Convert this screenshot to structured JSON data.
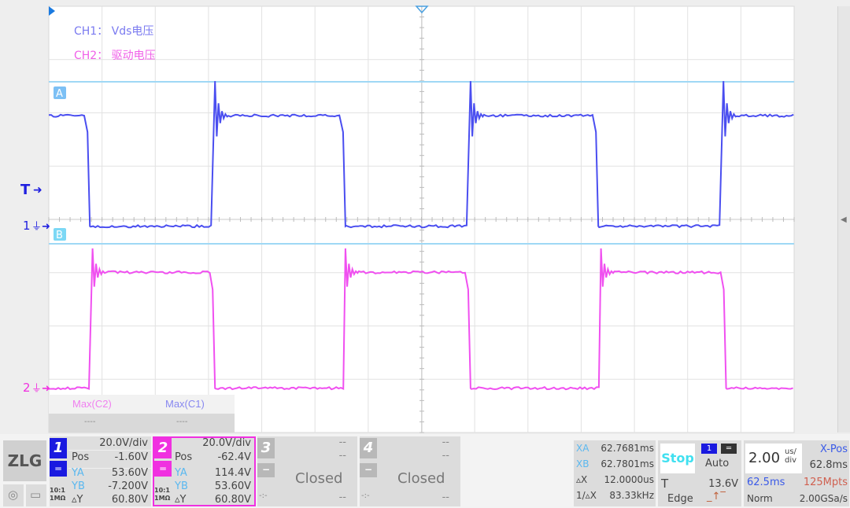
{
  "annotations": {
    "ch1": "CH1：  Vds电压",
    "ch2": "CH2：  驱动电压"
  },
  "markers": {
    "trigger": "T",
    "ch1": "1",
    "ch2": "2",
    "cursor_a": "A",
    "cursor_b": "B"
  },
  "colors": {
    "ch1": "#4a4ef0",
    "ch2": "#f050f0",
    "cursor": "#9fd8f5",
    "grid": "#dcdcdc"
  },
  "measurements": {
    "headers": [
      "Max(C2)",
      "Max(C1)"
    ],
    "values": [
      "----",
      "----"
    ]
  },
  "waveforms": {
    "time_unit": "us relative to screen center",
    "ch1": {
      "high_v": 41,
      "low_v": -0.5,
      "overshoot_v": 54,
      "edges": [
        {
          "t": -12.5,
          "dir": "fall"
        },
        {
          "t": -7.8,
          "dir": "rise"
        },
        {
          "t": -2.9,
          "dir": "fall"
        },
        {
          "t": 1.8,
          "dir": "rise"
        },
        {
          "t": 6.6,
          "dir": "fall"
        },
        {
          "t": 11.3,
          "dir": "rise"
        }
      ],
      "start": "high"
    },
    "ch2": {
      "high_v": 43,
      "low_v": -0.5,
      "overshoot_v": 52,
      "edges": [
        {
          "t": -12.4,
          "dir": "rise"
        },
        {
          "t": -7.8,
          "dir": "fall"
        },
        {
          "t": -2.9,
          "dir": "rise"
        },
        {
          "t": 1.8,
          "dir": "fall"
        },
        {
          "t": 6.7,
          "dir": "rise"
        },
        {
          "t": 11.4,
          "dir": "fall"
        }
      ],
      "start": "low"
    }
  },
  "logo": "ZLG",
  "channels": [
    {
      "num": "1",
      "scale": "20.0V/div",
      "pos_label": "Pos",
      "pos": "-1.60V",
      "ya_label": "YA",
      "ya": "53.60V",
      "yb_label": "YB",
      "yb": "-7.200V",
      "dy_label": "▵Y",
      "dy": "60.80V",
      "probe": "10:1",
      "imp": "1MΩ",
      "color": "#1a1ae0"
    },
    {
      "num": "2",
      "scale": "20.0V/div",
      "pos_label": "Pos",
      "pos": "-62.4V",
      "ya_label": "YA",
      "ya": "114.4V",
      "yb_label": "YB",
      "yb": "53.60V",
      "dy_label": "▵Y",
      "dy": "60.80V",
      "probe": "10:1",
      "imp": "1MΩ",
      "color": "#f030e0"
    },
    {
      "num": "3",
      "status": "Closed",
      "dash": "--",
      "coupling": "-:-"
    },
    {
      "num": "4",
      "status": "Closed",
      "dash": "--",
      "coupling": "-:-"
    }
  ],
  "cursors": {
    "xa_label": "XA",
    "xa": "62.7681ms",
    "xb_label": "XB",
    "xb": "62.7801ms",
    "dx_label": "▵X",
    "dx": "12.0000us",
    "inv_label": "1/▵X",
    "inv": "83.33kHz"
  },
  "trigger": {
    "state": "Stop",
    "source": "1",
    "mode": "Auto",
    "label": "T",
    "level": "13.6V",
    "type": "Edge"
  },
  "timebase": {
    "scale": "2.00",
    "unit_top": "us/",
    "unit_bottom": "div",
    "xpos_label": "X-Pos",
    "xpos": "62.8ms",
    "start": "62.5ms",
    "memory": "125Mpts",
    "acq": "Norm",
    "rate": "2.00GSa/s"
  }
}
